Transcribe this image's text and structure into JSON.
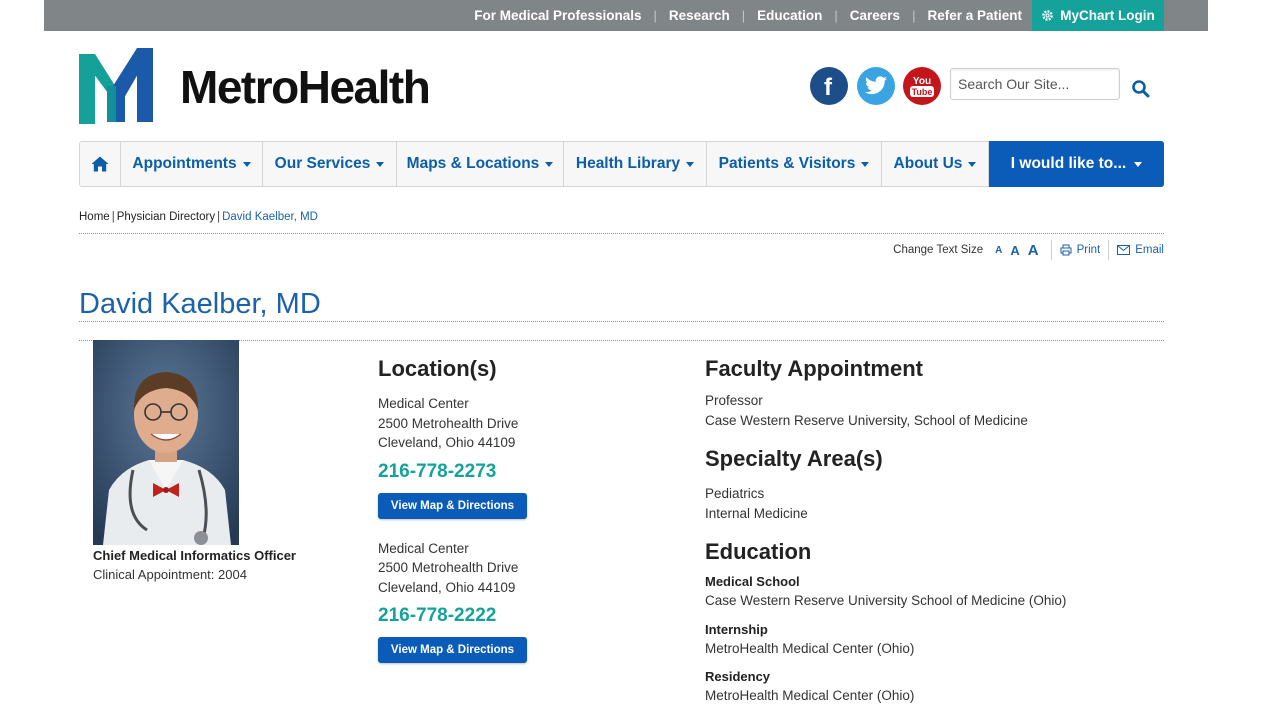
{
  "utility_bar": {
    "links": [
      "For Medical Professionals",
      "Research",
      "Education",
      "Careers",
      "Refer a Patient"
    ],
    "mychart_label": "MyChart Login"
  },
  "brand": {
    "name": "MetroHealth",
    "colors": {
      "teal": "#14a29a",
      "blue": "#0b5cb8"
    }
  },
  "social": {
    "facebook_icon": "facebook-icon",
    "twitter_icon": "twitter-icon",
    "youtube_label": "You Tube"
  },
  "search": {
    "placeholder": "Search Our Site..."
  },
  "nav": {
    "items": [
      "Appointments",
      "Our Services",
      "Maps & Locations",
      "Health Library",
      "Patients & Visitors",
      "About Us"
    ],
    "cta": "I would like to..."
  },
  "breadcrumb": {
    "home": "Home",
    "directory": "Physician Directory",
    "current": "David Kaelber, MD"
  },
  "tools": {
    "text_size_label": "Change Text Size",
    "size_letter": "A",
    "print": "Print",
    "email": "Email"
  },
  "physician": {
    "name": "David Kaelber, MD",
    "title": "Chief Medical Informatics Officer",
    "clinical_appointment": "Clinical Appointment: 2004"
  },
  "locations": {
    "heading": "Location(s)",
    "items": [
      {
        "name": "Medical Center",
        "street": "2500 Metrohealth Drive",
        "city": "Cleveland, Ohio 44109",
        "phone": "216-778-2273",
        "button": "View Map & Directions"
      },
      {
        "name": "Medical Center",
        "street": "2500 Metrohealth Drive",
        "city": "Cleveland, Ohio 44109",
        "phone": "216-778-2222",
        "button": "View Map & Directions"
      }
    ]
  },
  "faculty": {
    "heading": "Faculty Appointment",
    "role": "Professor",
    "institution": "Case Western Reserve University, School of Medicine"
  },
  "specialty": {
    "heading": "Specialty Area(s)",
    "items": [
      "Pediatrics",
      "Internal Medicine"
    ]
  },
  "education": {
    "heading": "Education",
    "entries": [
      {
        "label": "Medical School",
        "value": "Case Western Reserve University School of Medicine (Ohio)"
      },
      {
        "label": "Internship",
        "value": "MetroHealth Medical Center (Ohio)"
      },
      {
        "label": "Residency",
        "value": "MetroHealth Medical Center (Ohio)"
      }
    ]
  }
}
